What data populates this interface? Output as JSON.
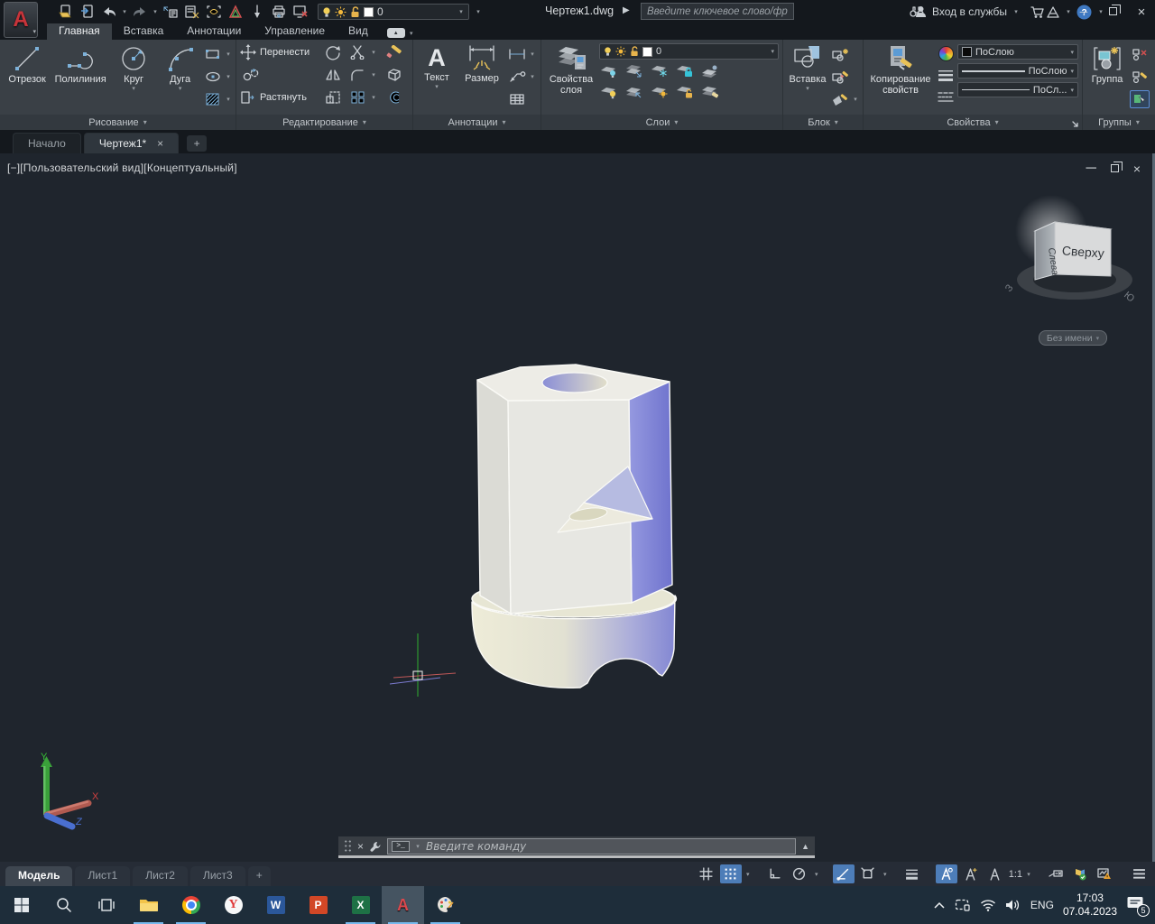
{
  "titlebar": {
    "doc_title": "Чертеж1.dwg",
    "search_placeholder": "Введите ключевое слово/фразу",
    "signin": "Вход в службы",
    "qat_layer": "0"
  },
  "ribbon": {
    "tabs": [
      "Главная",
      "Вставка",
      "Аннотации",
      "Управление",
      "Вид"
    ],
    "draw": {
      "title": "Рисование",
      "line": "Отрезок",
      "polyline": "Полилиния",
      "circle": "Круг",
      "arc": "Дуга"
    },
    "modify": {
      "title": "Редактирование",
      "move": "Перенести",
      "stretch": "Растянуть"
    },
    "annotate": {
      "title": "Аннотации",
      "text": "Текст",
      "dim": "Размер"
    },
    "layers": {
      "title": "Слои",
      "props": "Свойства слоя",
      "combo_layer": "0"
    },
    "block": {
      "title": "Блок",
      "insert": "Вставка"
    },
    "props": {
      "title": "Свойства",
      "match": "Копирование свойств",
      "color": "ПоСлою",
      "lineweight": "ПоСлою",
      "linetype": "ПоСл..."
    },
    "groups": {
      "title": "Группы",
      "group": "Группа"
    }
  },
  "file_tabs": {
    "start": "Начало",
    "drawing": "Чертеж1*"
  },
  "viewport": {
    "controls": "[−][Пользовательский вид][Концептуальный]",
    "viewcube": {
      "top": "Сверху",
      "left": "Слева",
      "ring_west": "З",
      "ring_south": "Ю"
    },
    "named_view": "Без имени",
    "ucs": {
      "x": "X",
      "y": "Y",
      "z": "Z"
    }
  },
  "command": {
    "prompt": ">_",
    "placeholder": "Введите команду"
  },
  "layout_tabs": {
    "model": "Модель",
    "sheet1": "Лист1",
    "sheet2": "Лист2",
    "sheet3": "Лист3"
  },
  "status": {
    "annotation_scale": "1:1"
  },
  "taskbar": {
    "language": "ENG",
    "time": "17:03",
    "date": "07.04.2023",
    "notification_count": "5"
  },
  "icons": {
    "qat": [
      "open-icon",
      "save-icon",
      "undo-icon",
      "redo-icon",
      "etransmit-icon",
      "markup-icon",
      "preview-icon",
      "set-square-icon",
      "plumb-icon",
      "print-icon",
      "screen-off-icon",
      "bulb-icon",
      "sun-icon",
      "lock-icon"
    ],
    "status": [
      "grid-display-icon",
      "snap-mode-icon",
      "ortho-icon",
      "polar-tracking-icon",
      "object-snap-tracking-icon",
      "object-snap-icon",
      "lineweight-display-icon",
      "annotation-visibility-icon",
      "annotation-autoscale-icon",
      "annotation-scale-icon",
      "quick-properties-icon",
      "hardware-acceleration-icon",
      "sysvar-monitor-icon",
      "customization-menu-icon"
    ],
    "taskbar_apps": [
      "start",
      "search",
      "task-view",
      "explorer",
      "chrome",
      "yandex-browser",
      "word",
      "powerpoint",
      "excel",
      "autocad",
      "paint"
    ]
  }
}
